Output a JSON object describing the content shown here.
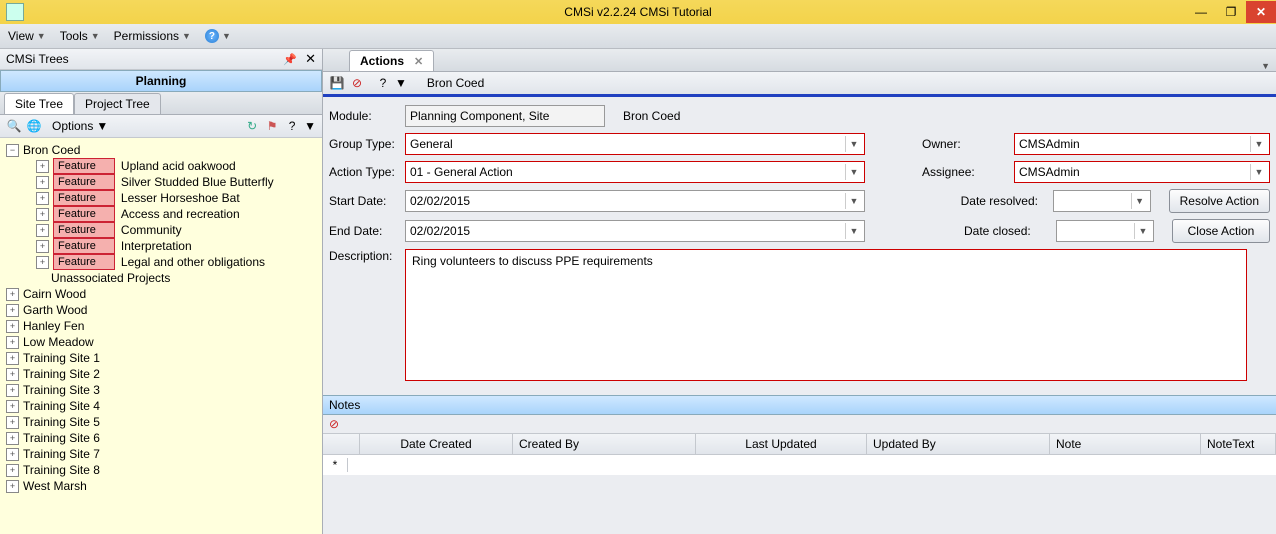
{
  "window": {
    "title": "CMSi v2.2.24 CMSi Tutorial"
  },
  "menu": {
    "view": "View",
    "tools": "Tools",
    "permissions": "Permissions"
  },
  "leftPanel": {
    "title": "CMSi Trees",
    "planning": "Planning",
    "tabs": {
      "site": "Site Tree",
      "project": "Project Tree"
    },
    "options": "Options",
    "root": "Bron Coed",
    "features": [
      "Upland acid oakwood",
      "Silver Studded Blue Butterfly",
      "Lesser Horseshoe Bat",
      "Access and recreation",
      "Community",
      "Interpretation",
      "Legal and other obligations"
    ],
    "featureBadge": "Feature",
    "unassoc": "Unassociated Projects",
    "sites": [
      "Cairn Wood",
      "Garth Wood",
      "Hanley Fen",
      "Low Meadow",
      "Training Site 1",
      "Training Site 2",
      "Training Site 3",
      "Training Site 4",
      "Training Site 5",
      "Training Site 6",
      "Training Site 7",
      "Training Site 8",
      "West Marsh"
    ]
  },
  "rightPanel": {
    "tab": "Actions",
    "breadcrumb": "Bron Coed",
    "labels": {
      "module": "Module:",
      "groupType": "Group Type:",
      "actionType": "Action Type:",
      "startDate": "Start Date:",
      "endDate": "End Date:",
      "description": "Description:",
      "owner": "Owner:",
      "assignee": "Assignee:",
      "dateResolved": "Date resolved:",
      "dateClosed": "Date closed:"
    },
    "values": {
      "module": "Planning Component, Site",
      "moduleSite": "Bron Coed",
      "groupType": "General",
      "actionType": "01 - General Action",
      "startDate": "02/02/2015",
      "endDate": "02/02/2015",
      "owner": "CMSAdmin",
      "assignee": "CMSAdmin",
      "dateResolved": "",
      "dateClosed": "",
      "description": "Ring volunteers to discuss PPE requirements"
    },
    "buttons": {
      "resolve": "Resolve Action",
      "close": "Close Action"
    },
    "notes": {
      "header": "Notes",
      "cols": [
        "Date Created",
        "Created By",
        "Last Updated",
        "Updated By",
        "Note",
        "NoteText"
      ]
    }
  }
}
